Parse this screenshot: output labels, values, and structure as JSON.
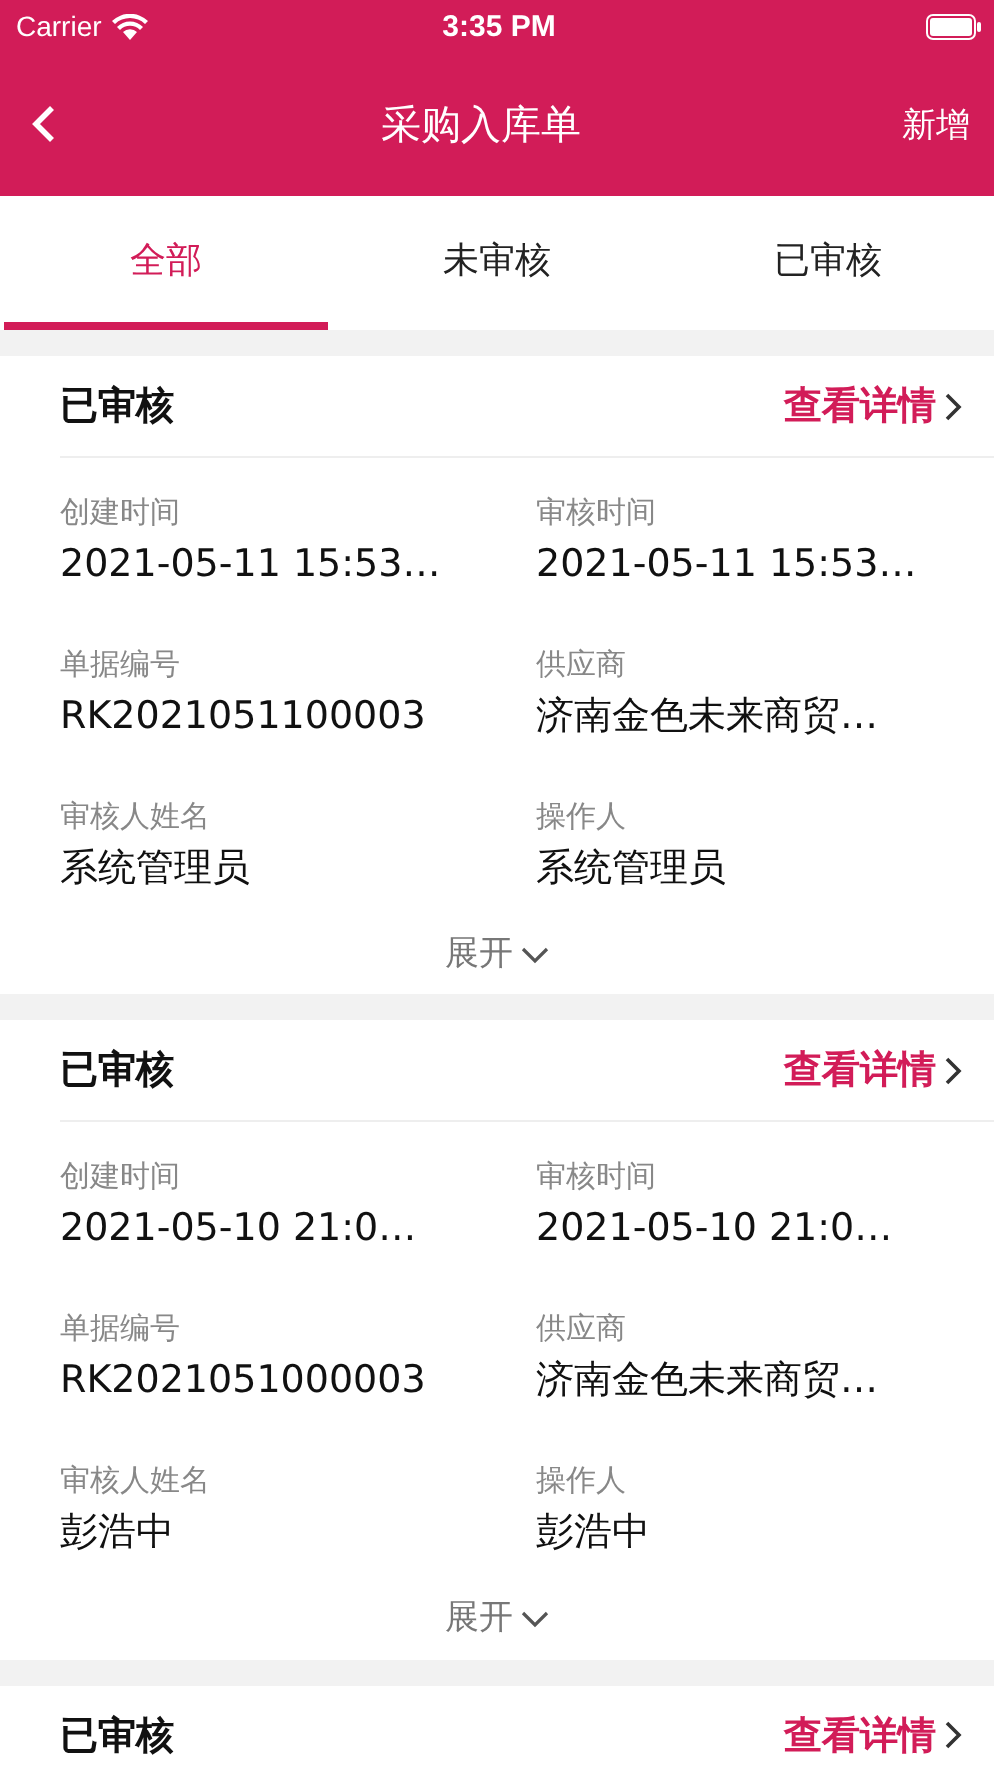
{
  "status_bar": {
    "carrier": "Carrier",
    "time": "3:35 PM"
  },
  "nav": {
    "title": "采购入库单",
    "action": "新增"
  },
  "tabs": [
    {
      "label": "全部",
      "selected": true
    },
    {
      "label": "未审核",
      "selected": false
    },
    {
      "label": "已审核",
      "selected": false
    }
  ],
  "cards": [
    {
      "status": "已审核",
      "link": "查看详情",
      "expand": "展开",
      "fields": [
        {
          "label": "创建时间",
          "value": "2021-05-11 15:53…"
        },
        {
          "label": "审核时间",
          "value": "2021-05-11 15:53…"
        },
        {
          "label": "单据编号",
          "value": "RK2021051100003"
        },
        {
          "label": "供应商",
          "value": "济南金色未来商贸…"
        },
        {
          "label": "审核人姓名",
          "value": "系统管理员"
        },
        {
          "label": "操作人",
          "value": "系统管理员"
        }
      ]
    },
    {
      "status": "已审核",
      "link": "查看详情",
      "expand": "展开",
      "fields": [
        {
          "label": "创建时间",
          "value": "2021-05-10 21:0…"
        },
        {
          "label": "审核时间",
          "value": "2021-05-10 21:0…"
        },
        {
          "label": "单据编号",
          "value": "RK2021051000003"
        },
        {
          "label": "供应商",
          "value": "济南金色未来商贸…"
        },
        {
          "label": "审核人姓名",
          "value": "彭浩中"
        },
        {
          "label": "操作人",
          "value": "彭浩中"
        }
      ]
    },
    {
      "status": "已审核",
      "link": "查看详情"
    }
  ]
}
